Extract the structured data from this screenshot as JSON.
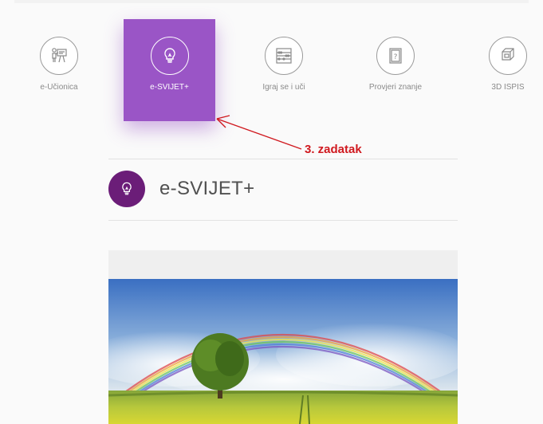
{
  "nav": {
    "items": [
      {
        "label": "e-Učionica",
        "icon": "teacher-board-icon",
        "active": false
      },
      {
        "label": "e-SVIJET+",
        "icon": "lightbulb-icon",
        "active": true
      },
      {
        "label": "Igraj se i uči",
        "icon": "abacus-icon",
        "active": false
      },
      {
        "label": "Provjeri znanje",
        "icon": "question-book-icon",
        "active": false
      },
      {
        "label": "3D ISPIS",
        "icon": "3d-cube-icon",
        "active": false
      }
    ]
  },
  "annotation": {
    "text": "3. zadatak",
    "color": "#d0191f"
  },
  "section": {
    "title": "e-SVIJET+",
    "icon": "lightbulb-icon",
    "icon_color": "#6b1d78"
  },
  "colors": {
    "accent": "#9a55c6"
  },
  "card": {
    "image": "rainbow-tree-field-image"
  }
}
